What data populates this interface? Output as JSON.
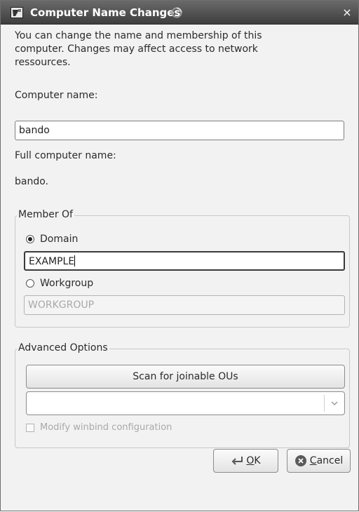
{
  "window": {
    "title": "Computer Name Changes",
    "close_glyph": "×"
  },
  "description": "You can change the name and membership of this\ncomputer. Changes may affect access to network\nressources.",
  "computer_name": {
    "label": "Computer name:",
    "value": "bando"
  },
  "full_computer_name": {
    "label": "Full computer name:",
    "value": "bando."
  },
  "member_of": {
    "legend": "Member Of",
    "domain_label": "Domain",
    "domain_selected": true,
    "domain_value": "EXAMPLE",
    "workgroup_label": "Workgroup",
    "workgroup_selected": false,
    "workgroup_value": "WORKGROUP"
  },
  "advanced": {
    "legend": "Advanced Options",
    "scan_button": "Scan for joinable OUs",
    "ou_selected": "",
    "modify_winbind_label": "Modify winbind configuration",
    "modify_winbind_checked": false
  },
  "buttons": {
    "ok_mnemonic": "O",
    "ok_rest": "K",
    "cancel_mnemonic": "C",
    "cancel_rest": "ancel"
  },
  "icons": {
    "app": "app-icon",
    "busy": "busy-spinner-icon",
    "close": "close-icon",
    "ok": "ok-arrow-icon",
    "cancel": "cancel-icon",
    "dropdown": "chevron-down-icon"
  },
  "colors": {
    "titlebar": "#4a4a4a",
    "window_bg": "#f2f2f2",
    "disabled_text": "#a9a9a9",
    "cancel_icon": "#555555"
  }
}
